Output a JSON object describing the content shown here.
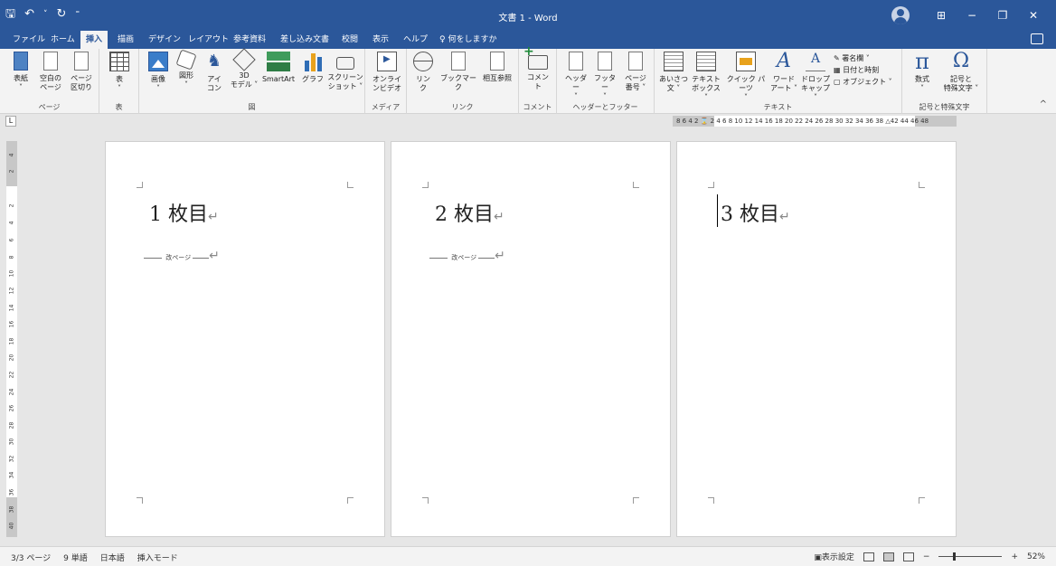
{
  "titlebar": {
    "title": "文書 1 - Word",
    "qat": {
      "save": "🖫",
      "undo": "↶",
      "undo_dropdown": "˅",
      "redo": "↻",
      "customize": "⁼"
    },
    "window": {
      "ribbon_display": "⊞",
      "minimize": "−",
      "restore": "❐",
      "close": "✕"
    }
  },
  "tabs": [
    {
      "label": "ファイル"
    },
    {
      "label": "ホーム"
    },
    {
      "label": "挿入"
    },
    {
      "label": "描画"
    },
    {
      "label": "デザイン"
    },
    {
      "label": "レイアウト"
    },
    {
      "label": "参考資料"
    },
    {
      "label": "差し込み文書"
    },
    {
      "label": "校閲"
    },
    {
      "label": "表示"
    },
    {
      "label": "ヘルプ"
    }
  ],
  "tellme": "♀ 何をしますか",
  "ribbon": {
    "groups": {
      "page": "ページ",
      "table": "表",
      "illustrations": "図",
      "media": "メディア",
      "links": "リンク",
      "comments": "コメント",
      "header_footer": "ヘッダーとフッター",
      "text": "テキスト",
      "symbols": "記号と特殊文字"
    },
    "buttons": {
      "cover": [
        "表紙",
        "˅"
      ],
      "blank_page": [
        "空白の",
        "ページ"
      ],
      "page_break": [
        "ページ",
        "区切り"
      ],
      "table": [
        "表",
        "˅"
      ],
      "picture": [
        "画像",
        "˅"
      ],
      "shapes": [
        "図形",
        "˅"
      ],
      "icons": [
        "アイ",
        "コン"
      ],
      "model3d": [
        "3D",
        "モデル ˅"
      ],
      "smartart": [
        "SmartArt",
        ""
      ],
      "chart": [
        "グラフ",
        ""
      ],
      "screenshot": [
        "スクリーン",
        "ショット ˅"
      ],
      "online_video": [
        "オンライ",
        "ンビデオ"
      ],
      "link": [
        "リン",
        "ク"
      ],
      "bookmark": [
        "ブックマーク",
        ""
      ],
      "cross_ref": [
        "相互参照",
        ""
      ],
      "comment": [
        "コメント",
        ""
      ],
      "header": [
        "ヘッダー",
        "˅"
      ],
      "footer": [
        "フッター",
        "˅"
      ],
      "page_number": [
        "ページ",
        "番号 ˅"
      ],
      "greeting": [
        "あいさつ",
        "文 ˅"
      ],
      "textbox": [
        "テキスト",
        "ボックス ˅"
      ],
      "quick_parts": [
        "クイック パーツ",
        "˅"
      ],
      "wordart": [
        "ワード",
        "アート ˅"
      ],
      "dropcap": [
        "ドロップ",
        "キャップ ˅"
      ],
      "equation": [
        "数式",
        "˅"
      ],
      "symbol": [
        "記号と",
        "特殊文字 ˅"
      ]
    },
    "text_small": {
      "signature": "署名欄  ˅",
      "datetime": "日付と時刻",
      "object": "オブジェクト  ˅"
    }
  },
  "ruler": {
    "tab_selector": "L",
    "horizontal": "8  6  4  2  ⌛  2  4  6  8 10 12 14 16 18 20 22 24 26 28 30 32 34 36 38  △42 44 46 48",
    "vertical": [
      "4",
      "2",
      "2",
      "4",
      "6",
      "8",
      "10",
      "12",
      "14",
      "16",
      "18",
      "20",
      "22",
      "24",
      "26",
      "28",
      "30",
      "32",
      "34",
      "36",
      "38",
      "40"
    ]
  },
  "pages": [
    {
      "text": "1 枚目",
      "mark": "↵",
      "break_label": "改ページ",
      "break_mark": "↵"
    },
    {
      "text": "2 枚目",
      "mark": "↵",
      "break_label": "改ページ",
      "break_mark": "↵"
    },
    {
      "text": "3 枚目",
      "mark": "↵"
    }
  ],
  "statusbar": {
    "page": "3/3 ページ",
    "words": "9 単語",
    "language": "日本語",
    "mode": "挿入モード",
    "display_settings": "表示設定",
    "zoom_minus": "−",
    "zoom_plus": "+",
    "zoom": "52%"
  },
  "colors": {
    "accent": "#2b579a",
    "ribbon_bg": "#f3f3f3",
    "workspace": "#e6e6e6"
  }
}
